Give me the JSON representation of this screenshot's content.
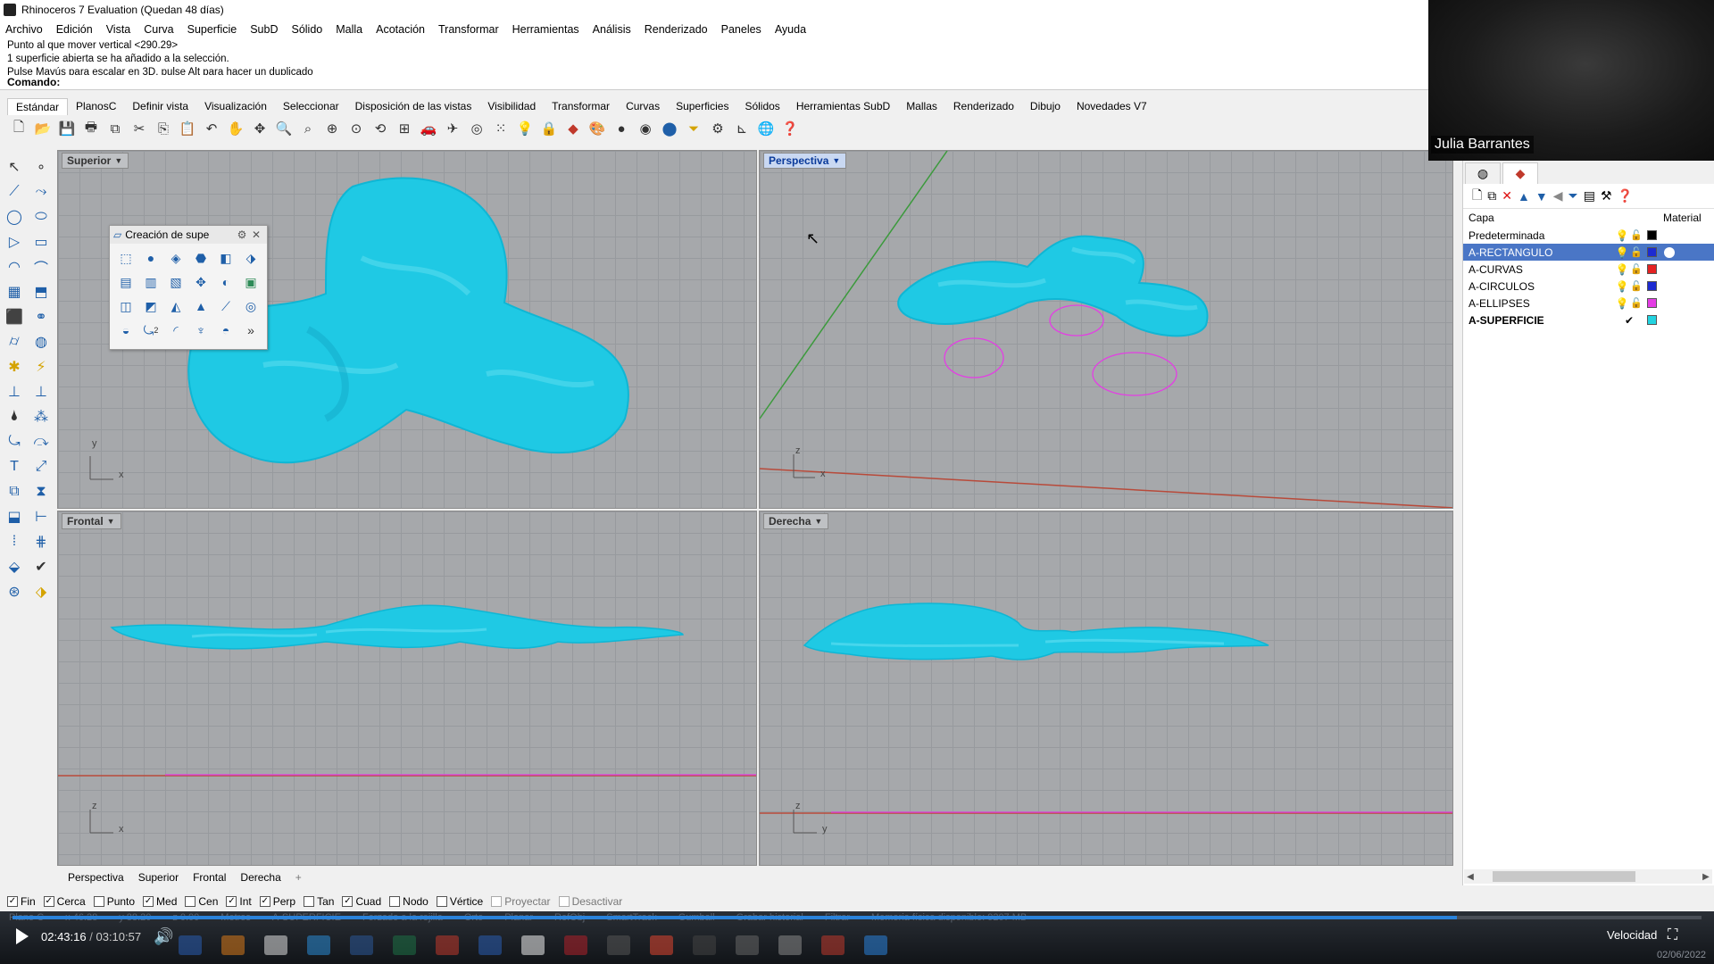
{
  "window": {
    "title": "Rhinoceros 7 Evaluation (Quedan 48 días)"
  },
  "menu": [
    "Archivo",
    "Edición",
    "Vista",
    "Curva",
    "Superficie",
    "SubD",
    "Sólido",
    "Malla",
    "Acotación",
    "Transformar",
    "Herramientas",
    "Análisis",
    "Renderizado",
    "Paneles",
    "Ayuda"
  ],
  "command": {
    "history": [
      "Punto al que mover vertical <290.29>",
      "1 superficie abierta se ha añadido a la selección.",
      "Pulse Mayús para escalar en 3D, pulse Alt para hacer un duplicado"
    ],
    "prompt": "Comando:",
    "value": ""
  },
  "toolbar_tabs": {
    "items": [
      "Estándar",
      "PlanosC",
      "Definir vista",
      "Visualización",
      "Seleccionar",
      "Disposición de las vistas",
      "Visibilidad",
      "Transformar",
      "Curvas",
      "Superficies",
      "Sólidos",
      "Herramientas SubD",
      "Mallas",
      "Renderizado",
      "Dibujo",
      "Novedades V7"
    ],
    "active": 0
  },
  "viewports": {
    "top": {
      "label": "Superior",
      "axis_y": "y",
      "axis_x": "x"
    },
    "perspective": {
      "label": "Perspectiva",
      "axis_z": "z",
      "axis_x": "x"
    },
    "front": {
      "label": "Frontal",
      "axis_z": "z",
      "axis_x": "x"
    },
    "right": {
      "label": "Derecha",
      "axis_z": "z",
      "axis_y": "y"
    }
  },
  "floating_panel": {
    "title": "Creación de supe",
    "more": "»",
    "badge": "2"
  },
  "viewport_tabs": {
    "items": [
      "Perspectiva",
      "Superior",
      "Frontal",
      "Derecha"
    ],
    "add": "+"
  },
  "osnaps": [
    {
      "label": "Fin",
      "checked": true,
      "enabled": true
    },
    {
      "label": "Cerca",
      "checked": true,
      "enabled": true
    },
    {
      "label": "Punto",
      "checked": false,
      "enabled": true
    },
    {
      "label": "Med",
      "checked": true,
      "enabled": true
    },
    {
      "label": "Cen",
      "checked": false,
      "enabled": true
    },
    {
      "label": "Int",
      "checked": true,
      "enabled": true
    },
    {
      "label": "Perp",
      "checked": true,
      "enabled": true
    },
    {
      "label": "Tan",
      "checked": false,
      "enabled": true
    },
    {
      "label": "Cuad",
      "checked": true,
      "enabled": true
    },
    {
      "label": "Nodo",
      "checked": false,
      "enabled": true
    },
    {
      "label": "Vértice",
      "checked": false,
      "enabled": true
    },
    {
      "label": "Proyectar",
      "checked": false,
      "enabled": false
    },
    {
      "label": "Desactivar",
      "checked": false,
      "enabled": false
    }
  ],
  "statusbar_ghost": [
    "Plano C",
    "x 46.28",
    "y 88.20",
    "z 0.00",
    "Metros",
    "A-SUPERFICIE",
    "Forzado a la rejilla",
    "Orto",
    "Planar",
    "RefObj",
    "SmartTrack",
    "Gumball",
    "Grabar historial",
    "Filtrar",
    "Memoria física disponible: 9207 MB"
  ],
  "webcam": {
    "name": "Julia Barrantes"
  },
  "layers": {
    "header_capa": "Capa",
    "header_material": "Material",
    "rows": [
      {
        "name": "Predeterminada",
        "color": "#000000",
        "selected": false,
        "current": false,
        "material": ""
      },
      {
        "name": "A-RECTANGULO",
        "color": "#1d2bd1",
        "selected": true,
        "current": false,
        "material": "#ffffff"
      },
      {
        "name": "A-CURVAS",
        "color": "#e52222",
        "selected": false,
        "current": false,
        "material": ""
      },
      {
        "name": "A-CIRCULOS",
        "color": "#1d2bd1",
        "selected": false,
        "current": false,
        "material": ""
      },
      {
        "name": "A-ELLIPSES",
        "color": "#e43de4",
        "selected": false,
        "current": false,
        "material": ""
      },
      {
        "name": "A-SUPERFICIE",
        "color": "#22d3e0",
        "selected": false,
        "current": true,
        "material": ""
      }
    ]
  },
  "player": {
    "current_time": "02:43:16",
    "separator": "/",
    "total_time": "03:10:57",
    "progress": 0.855,
    "speed_label": "Velocidad",
    "date": "02/06/2022"
  },
  "colors": {
    "surface": "#1fc9e4",
    "accent": "#2a82da",
    "layer_select": "#4a76c6"
  }
}
